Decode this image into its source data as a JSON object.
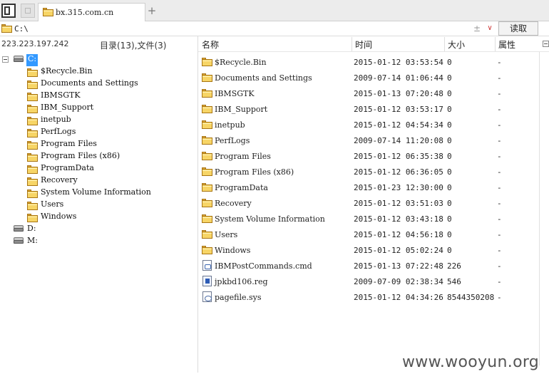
{
  "tab": {
    "title": "bx.315.com.cn",
    "add_symbol": "+"
  },
  "address": {
    "path": "C:\\",
    "plus_symbol": "±",
    "dropdown_symbol": "∨",
    "read_button": "读取"
  },
  "info": {
    "ip": "223.223.197.242",
    "counts": "目录(13),文件(3)"
  },
  "columns": {
    "name": "名称",
    "time": "时间",
    "size": "大小",
    "attr": "属性"
  },
  "tree": {
    "root_drive": "C:",
    "folders": [
      "$Recycle.Bin",
      "Documents and Settings",
      "IBMSGTK",
      "IBM_Support",
      "inetpub",
      "PerfLogs",
      "Program Files",
      "Program Files (x86)",
      "ProgramData",
      "Recovery",
      "System Volume Information",
      "Users",
      "Windows"
    ],
    "other_drives": [
      "D:",
      "M:"
    ]
  },
  "entries": [
    {
      "name": "$Recycle.Bin",
      "time": "2015-01-12 03:53:54",
      "size": "0",
      "attr": "-",
      "icon": "folder-icon"
    },
    {
      "name": "Documents and Settings",
      "time": "2009-07-14 01:06:44",
      "size": "0",
      "attr": "-",
      "icon": "folder-icon"
    },
    {
      "name": "IBMSGTK",
      "time": "2015-01-13 07:20:48",
      "size": "0",
      "attr": "-",
      "icon": "folder-icon"
    },
    {
      "name": "IBM_Support",
      "time": "2015-01-12 03:53:17",
      "size": "0",
      "attr": "-",
      "icon": "folder-icon"
    },
    {
      "name": "inetpub",
      "time": "2015-01-12 04:54:34",
      "size": "0",
      "attr": "-",
      "icon": "folder-icon"
    },
    {
      "name": "PerfLogs",
      "time": "2009-07-14 11:20:08",
      "size": "0",
      "attr": "-",
      "icon": "folder-icon"
    },
    {
      "name": "Program Files",
      "time": "2015-01-12 06:35:38",
      "size": "0",
      "attr": "-",
      "icon": "folder-icon"
    },
    {
      "name": "Program Files (x86)",
      "time": "2015-01-12 06:36:05",
      "size": "0",
      "attr": "-",
      "icon": "folder-icon"
    },
    {
      "name": "ProgramData",
      "time": "2015-01-23 12:30:00",
      "size": "0",
      "attr": "-",
      "icon": "folder-icon"
    },
    {
      "name": "Recovery",
      "time": "2015-01-12 03:51:03",
      "size": "0",
      "attr": "-",
      "icon": "folder-icon"
    },
    {
      "name": "System Volume Information",
      "time": "2015-01-12 03:43:18",
      "size": "0",
      "attr": "-",
      "icon": "folder-icon"
    },
    {
      "name": "Users",
      "time": "2015-01-12 04:56:18",
      "size": "0",
      "attr": "-",
      "icon": "folder-icon"
    },
    {
      "name": "Windows",
      "time": "2015-01-12 05:02:24",
      "size": "0",
      "attr": "-",
      "icon": "folder-icon"
    },
    {
      "name": "IBMPostCommands.cmd",
      "time": "2015-01-13 07:22:48",
      "size": "226",
      "attr": "-",
      "icon": "cmd-file-icon"
    },
    {
      "name": "jpkbd106.reg",
      "time": "2009-07-09 02:38:34",
      "size": "546",
      "attr": "-",
      "icon": "reg-file-icon"
    },
    {
      "name": "pagefile.sys",
      "time": "2015-01-12 04:34:26",
      "size": "8544350208",
      "attr": "-",
      "icon": "sys-file-icon"
    }
  ],
  "watermark": "www.wooyun.org",
  "colors": {
    "selection": "#3399ff",
    "folder": "#f7d566"
  }
}
